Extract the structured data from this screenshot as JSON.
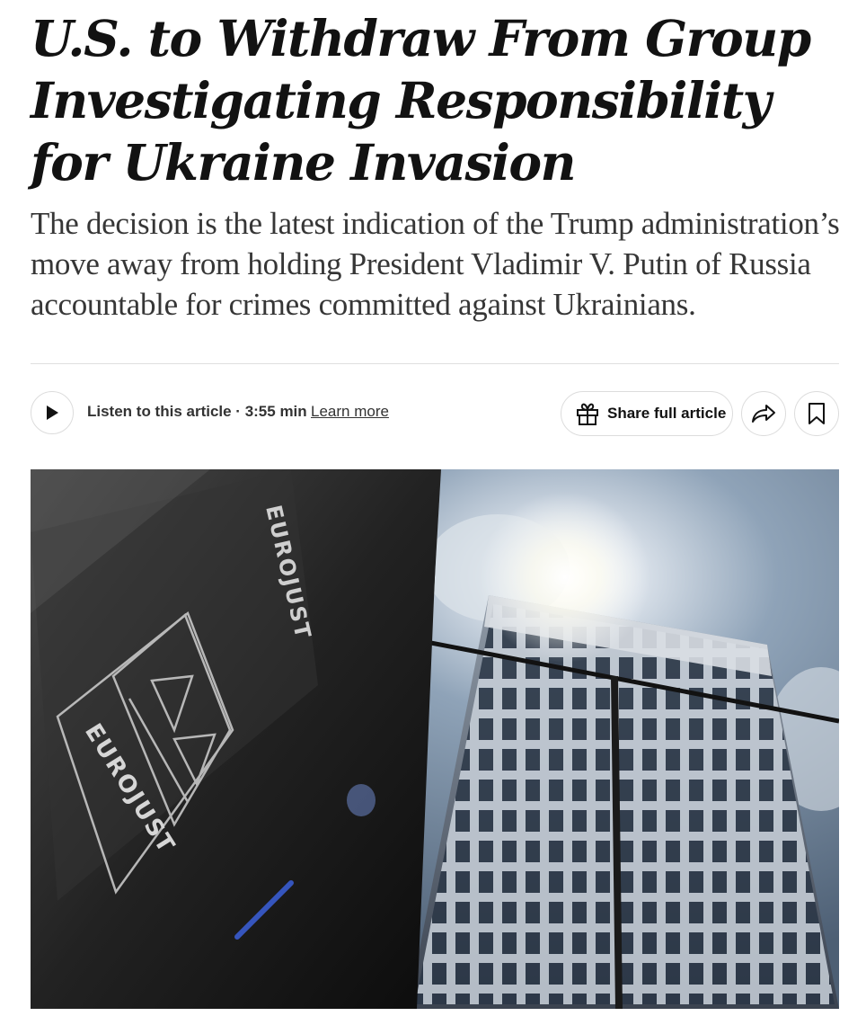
{
  "article": {
    "headline": "U.S. to Withdraw From Group Investigating Responsibility for Ukraine Invasion",
    "summary": "The decision is the latest indication of the Trump administration’s move away from holding President Vladimir V. Putin of Russia accountable for crimes committed against Ukrainians."
  },
  "audio": {
    "listen_label": "Listen to this article · 3:55 min",
    "learn_more": "Learn more",
    "play_icon": "play-icon"
  },
  "actions": {
    "share_full_label": "Share full article",
    "gift_icon": "gift-icon",
    "share_icon": "share-arrow-icon",
    "bookmark_icon": "bookmark-icon"
  },
  "photo": {
    "sign_text": "EUROJUST",
    "logo_text": "EUROJUST"
  },
  "colors": {
    "text": "#121212",
    "summary_text": "#363636",
    "border": "#dcdcdc"
  }
}
